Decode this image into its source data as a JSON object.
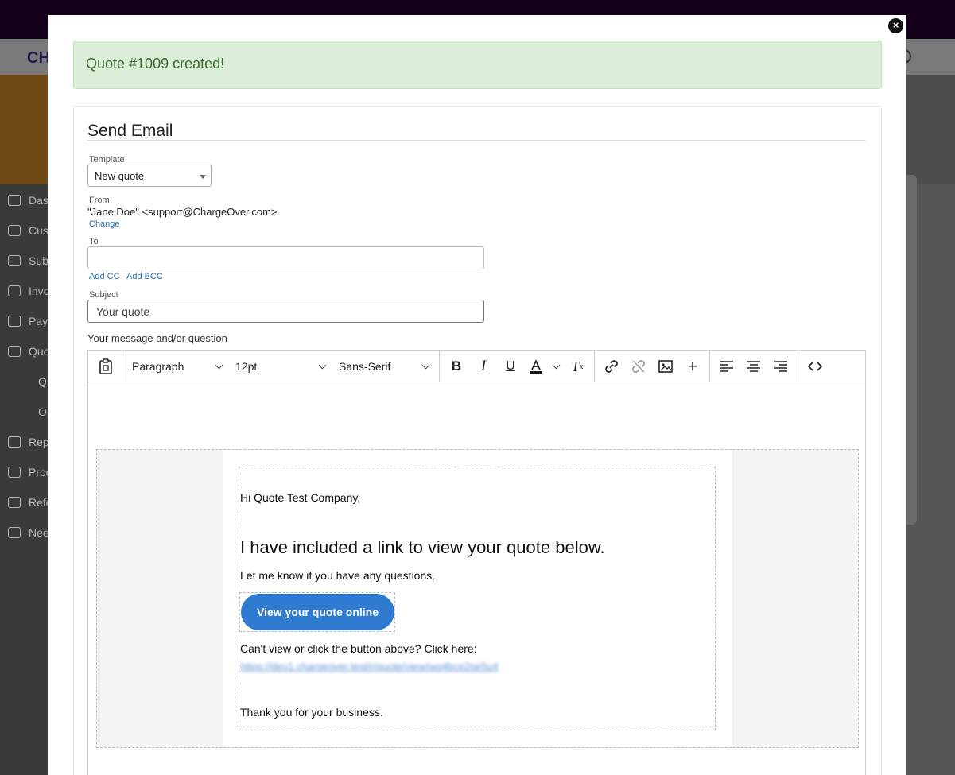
{
  "background": {
    "logo": "CH",
    "nav": [
      {
        "label": "Dashboard",
        "icon": "dashboard-icon"
      },
      {
        "label": "Customers",
        "icon": "users-icon"
      },
      {
        "label": "Subscriptions",
        "icon": "calendar-icon"
      },
      {
        "label": "Invoices",
        "icon": "invoice-icon"
      },
      {
        "label": "Payments",
        "icon": "payment-icon"
      },
      {
        "label": "Quotes",
        "icon": "document-icon"
      },
      {
        "label": "Quotes",
        "icon": ""
      },
      {
        "label": "Opportunities",
        "icon": ""
      },
      {
        "label": "Reports",
        "icon": "chart-icon"
      },
      {
        "label": "Products",
        "icon": "gift-icon"
      },
      {
        "label": "Referrals",
        "icon": "gift-icon"
      },
      {
        "label": "Need Help?",
        "icon": "help-icon"
      }
    ]
  },
  "alert": {
    "text": "Quote #1009 created!"
  },
  "form": {
    "title": "Send Email",
    "template_label": "Template",
    "template_value": "New quote",
    "from_label": "From",
    "from_value": "\"Jane Doe\" <support@ChargeOver.com>",
    "change_link": "Change",
    "to_label": "To",
    "to_value": "",
    "add_cc": "Add CC",
    "add_bcc": "Add BCC",
    "subject_label": "Subject",
    "subject_value": "Your quote",
    "message_label": "Your message and/or question"
  },
  "toolbar": {
    "block_format": "Paragraph",
    "font_size": "12pt",
    "font_family": "Sans-Serif"
  },
  "email": {
    "greeting": "Hi Quote Test Company,",
    "headline": "I have included a link to view your quote below.",
    "questions": "Let me know if you have any questions.",
    "button": "View your quote online",
    "fallback": "Can't view or click the button above? Click here:",
    "url": "https://dev1.chargeover.test/r/quote/view/wq4bce2se5u4",
    "thanks": "Thank you for your business."
  }
}
